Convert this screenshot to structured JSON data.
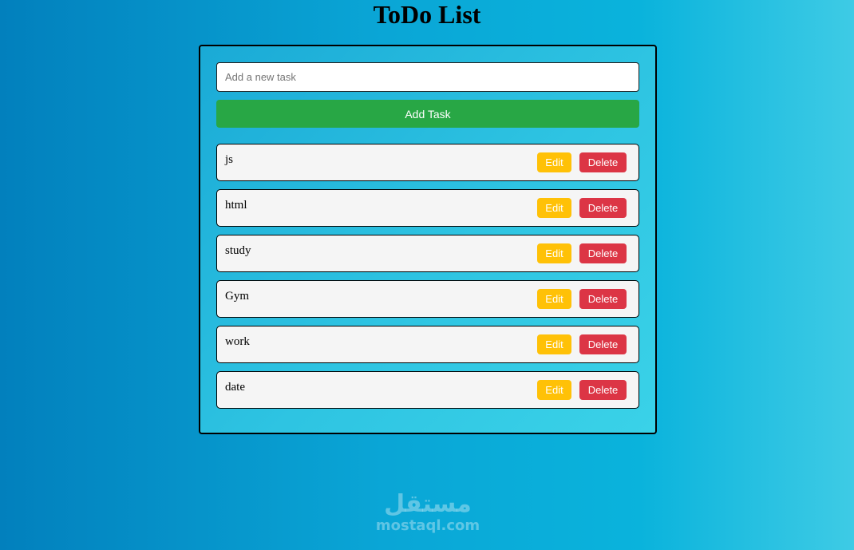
{
  "page": {
    "title": "ToDo List"
  },
  "form": {
    "input_value": "",
    "input_placeholder": "Add a new task",
    "add_button_label": "Add Task"
  },
  "tasks": [
    {
      "text": "js",
      "edit_label": "Edit",
      "delete_label": "Delete"
    },
    {
      "text": "html",
      "edit_label": "Edit",
      "delete_label": "Delete"
    },
    {
      "text": "study",
      "edit_label": "Edit",
      "delete_label": "Delete"
    },
    {
      "text": "Gym",
      "edit_label": "Edit",
      "delete_label": "Delete"
    },
    {
      "text": "work",
      "edit_label": "Edit",
      "delete_label": "Delete"
    },
    {
      "text": "date",
      "edit_label": "Edit",
      "delete_label": "Delete"
    }
  ],
  "watermark": {
    "arabic": "مستقل",
    "latin": "mostaql.com"
  },
  "colors": {
    "add_button": "#28a745",
    "edit_button": "#ffc107",
    "delete_button": "#dc3545",
    "task_background": "#f5f5f5"
  }
}
